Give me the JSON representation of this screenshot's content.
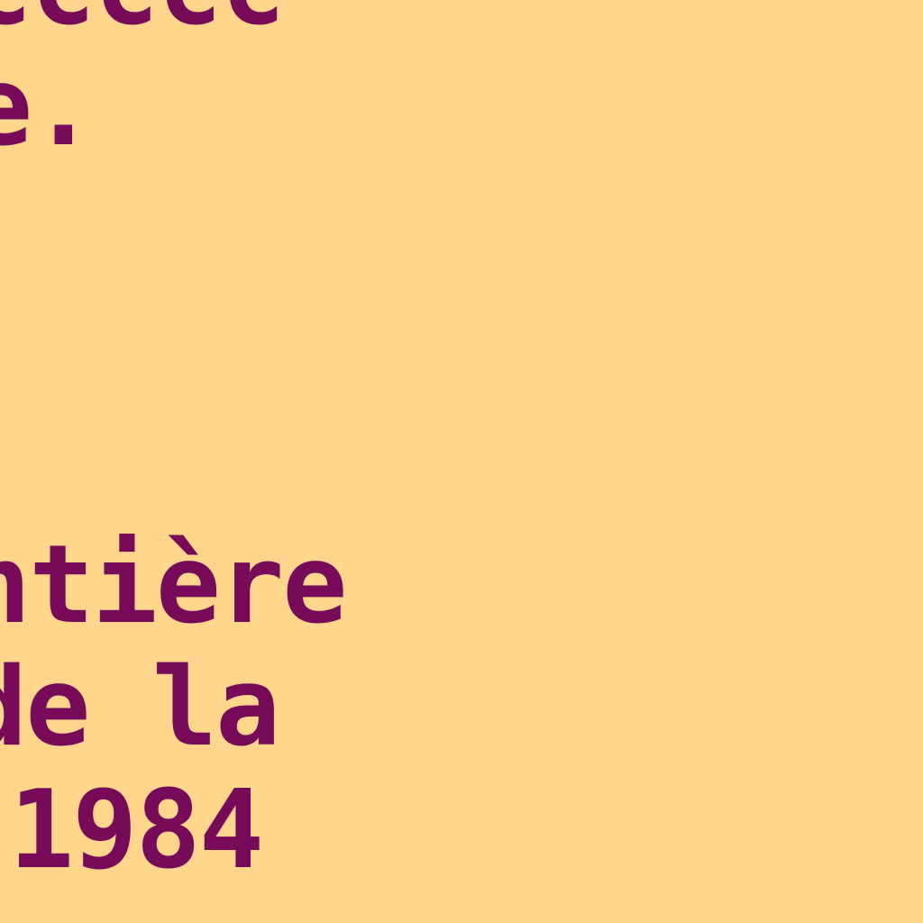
{
  "screen": {
    "background_color": "#FFD68C",
    "text_color": "#780A5A",
    "lines": [
      "ccccc",
      "e.",
      "ntière",
      "de la",
      "1984"
    ]
  }
}
